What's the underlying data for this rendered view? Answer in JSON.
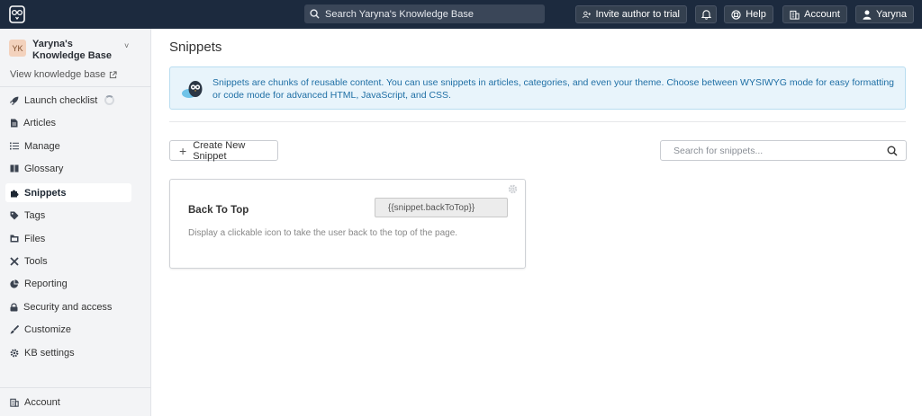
{
  "topbar": {
    "search_label": "Search Yaryna's Knowledge Base",
    "invite_label": "Invite author to trial",
    "help_label": "Help",
    "account_label": "Account",
    "user_label": "Yaryna"
  },
  "sidebar": {
    "kb_initials": "YK",
    "kb_name": "Yaryna's Knowledge Base",
    "view_kb_label": "View knowledge base",
    "items": [
      {
        "label": "Launch checklist",
        "icon": "rocket-icon"
      },
      {
        "label": "Articles",
        "icon": "file-icon"
      },
      {
        "label": "Manage",
        "icon": "list-icon"
      },
      {
        "label": "Glossary",
        "icon": "book-icon"
      },
      {
        "label": "Snippets",
        "icon": "puzzle-icon",
        "active": true
      },
      {
        "label": "Tags",
        "icon": "tag-icon"
      },
      {
        "label": "Files",
        "icon": "folder-icon"
      },
      {
        "label": "Tools",
        "icon": "tools-icon"
      },
      {
        "label": "Reporting",
        "icon": "chart-icon"
      },
      {
        "label": "Security and access",
        "icon": "lock-icon"
      },
      {
        "label": "Customize",
        "icon": "brush-icon"
      },
      {
        "label": "KB settings",
        "icon": "gear-icon"
      }
    ],
    "account_label": "Account"
  },
  "main": {
    "title": "Snippets",
    "info_text": "Snippets are chunks of reusable content. You can use snippets in articles, categories, and even your theme. Choose between WYSIWYG mode for easy formatting or code mode for advanced HTML, JavaScript, and CSS.",
    "create_label": "Create New Snippet",
    "search_placeholder": "Search for snippets...",
    "snippets": [
      {
        "title": "Back To Top",
        "code": "{{snippet.backToTop}}",
        "description": "Display a clickable icon to take the user back to the top of the page."
      }
    ]
  },
  "colors": {
    "topbar_bg": "#1c2a3e",
    "sidebar_bg": "#f3f4f6",
    "info_bg": "#e8f4fb",
    "info_text": "#1f6fa5"
  }
}
